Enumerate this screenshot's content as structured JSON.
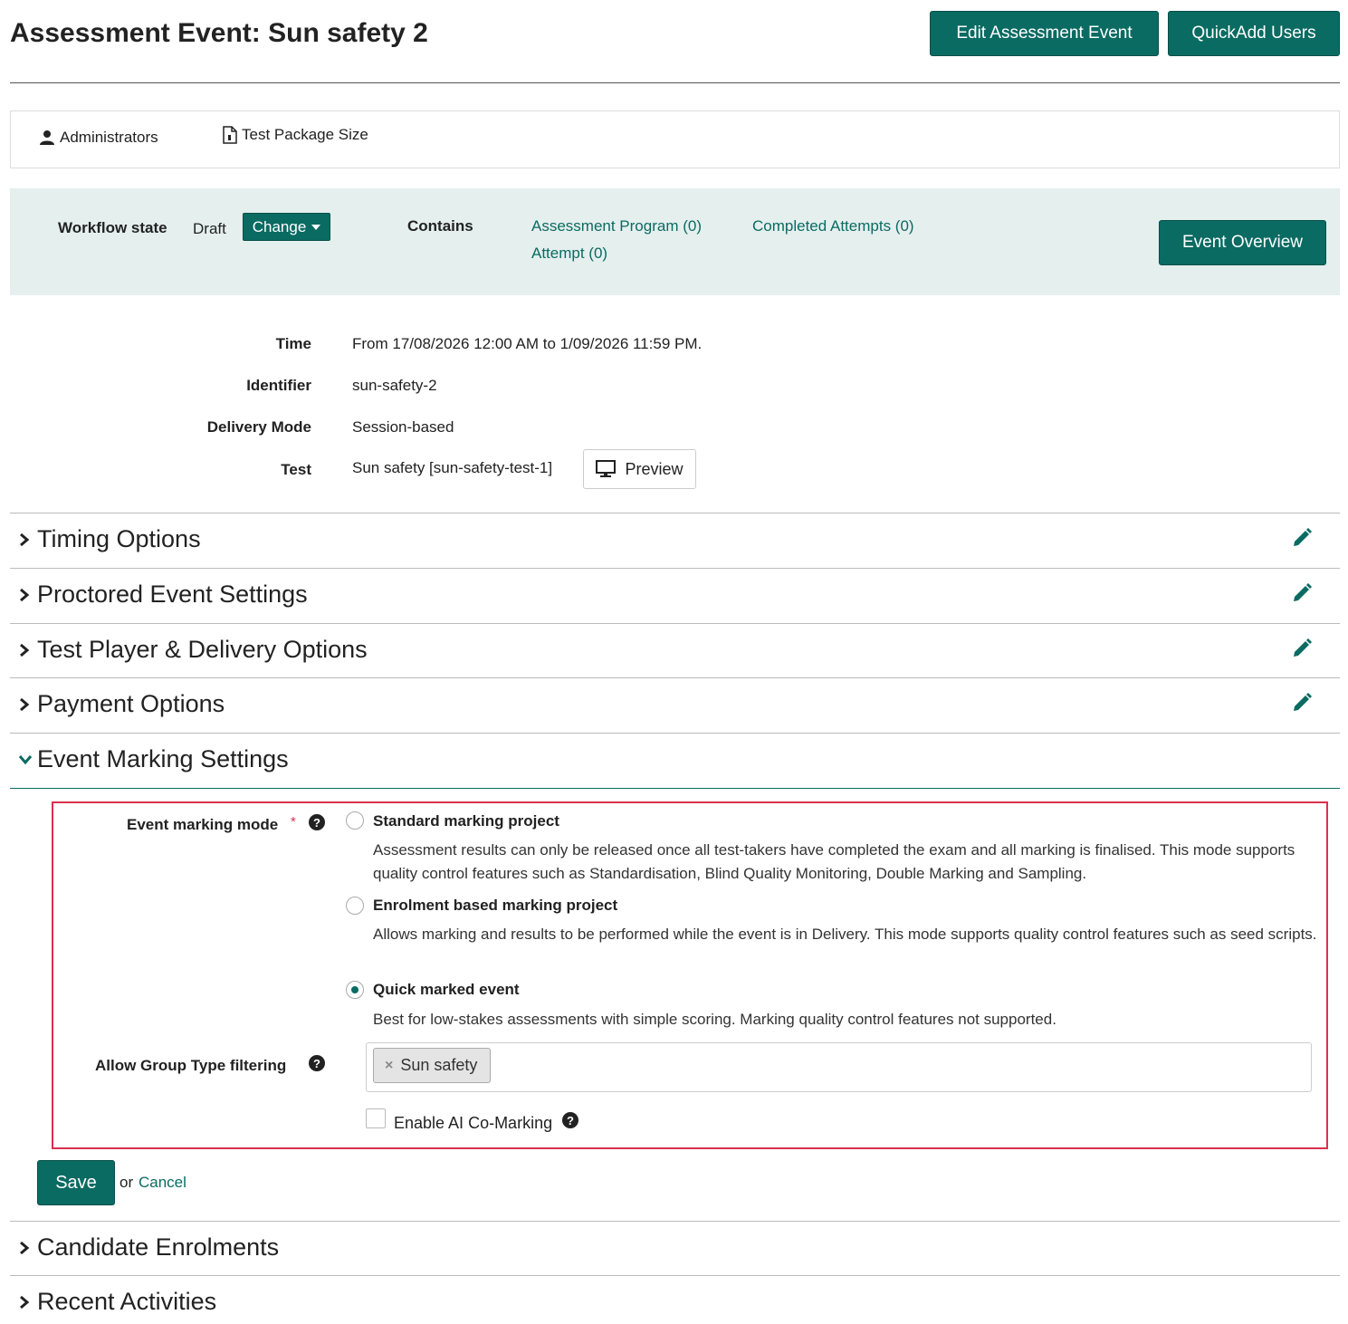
{
  "header": {
    "title": "Assessment Event: Sun safety 2",
    "edit_button": "Edit Assessment Event",
    "quickadd_button": "QuickAdd Users"
  },
  "tabs": [
    {
      "label": "Administrators",
      "icon": "user-icon"
    },
    {
      "label": "Test Package Size",
      "icon": "file-icon"
    }
  ],
  "workflow": {
    "state_label": "Workflow state",
    "state_value": "Draft",
    "change_button": "Change",
    "contains_label": "Contains",
    "links": [
      "Assessment Program (0)",
      "Completed Attempts (0)",
      "Attempt (0)"
    ],
    "overview_button": "Event Overview"
  },
  "details": {
    "time_label": "Time",
    "time_value": "From 17/08/2026 12:00 AM to 1/09/2026 11:59 PM.",
    "identifier_label": "Identifier",
    "identifier_value": "sun-safety-2",
    "delivery_label": "Delivery Mode",
    "delivery_value": "Session-based",
    "test_label": "Test",
    "test_value": "Sun safety [sun-safety-test-1]",
    "preview_button": "Preview"
  },
  "sections": [
    {
      "title": "Timing Options",
      "expanded": false,
      "editable": true
    },
    {
      "title": "Proctored Event Settings",
      "expanded": false,
      "editable": true
    },
    {
      "title": "Test Player & Delivery Options",
      "expanded": false,
      "editable": true
    },
    {
      "title": "Payment Options",
      "expanded": false,
      "editable": true
    },
    {
      "title": "Event Marking Settings",
      "expanded": true,
      "editable": false
    },
    {
      "title": "Candidate Enrolments",
      "expanded": false,
      "editable": false
    },
    {
      "title": "Recent Activities",
      "expanded": false,
      "editable": false
    }
  ],
  "marking": {
    "mode_label": "Event marking mode",
    "required_mark": "*",
    "options": [
      {
        "title": "Standard marking project",
        "selected": false,
        "desc": "Assessment results can only be released once all test-takers have completed the exam and all marking is finalised. This mode supports quality control features such as Standardisation, Blind Quality Monitoring, Double Marking and Sampling."
      },
      {
        "title": "Enrolment based marking project",
        "selected": false,
        "desc": "Allows marking and results to be performed while the event is in Delivery. This mode supports quality control features such as seed scripts."
      },
      {
        "title": "Quick marked event",
        "selected": true,
        "desc": "Best for low-stakes assessments with simple scoring. Marking quality control features not supported."
      }
    ],
    "group_filter_label": "Allow Group Type filtering",
    "group_filter_chip": "Sun safety",
    "ai_label": "Enable AI Co-Marking",
    "ai_checked": false,
    "save_button": "Save",
    "or_text": "or",
    "cancel_link": "Cancel"
  },
  "colors": {
    "accent": "#0a6b62",
    "highlight_border": "#d9304f",
    "workflow_bg": "#e4efee"
  }
}
